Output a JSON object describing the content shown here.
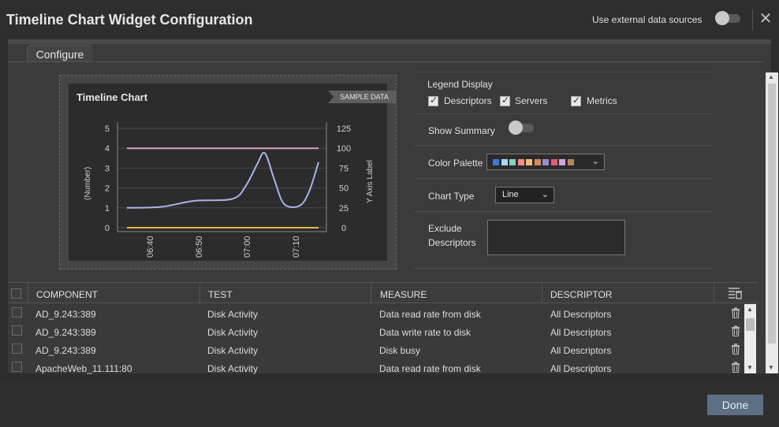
{
  "header": {
    "title": "Timeline Chart Widget Configuration",
    "external_sources_label": "Use external data sources",
    "external_sources_on": false
  },
  "tabs": [
    {
      "label": "Configure",
      "active": true
    }
  ],
  "preview": {
    "chart_title": "Timeline Chart",
    "badge": "SAMPLE DATA"
  },
  "chart_data": {
    "type": "line",
    "title": "Timeline Chart",
    "x": [
      "06:40",
      "06:50",
      "07:00",
      "07:10"
    ],
    "ylabel": "(Number)",
    "ylabel_right": "Y Axis Label",
    "yticks_left": [
      "0",
      "1",
      "2",
      "3",
      "4",
      "5"
    ],
    "yticks_right": [
      "0",
      "25",
      "50",
      "75",
      "100",
      "125"
    ],
    "ylim": [
      0,
      5
    ],
    "ylim_right": [
      0,
      125
    ],
    "grid": true,
    "series": [
      {
        "color": "#d8a0c8",
        "axis": "left",
        "points": [
          [
            0,
            4.0
          ],
          [
            1,
            4.0
          ]
        ]
      },
      {
        "color": "#e8b84a",
        "axis": "left",
        "points": [
          [
            0,
            0.0
          ],
          [
            1,
            0.0
          ]
        ]
      },
      {
        "color": "#aab4e8",
        "axis": "left",
        "points": [
          [
            0.0,
            1.0
          ],
          [
            0.18,
            1.05
          ],
          [
            0.35,
            1.35
          ],
          [
            0.55,
            1.45
          ],
          [
            0.62,
            2.1
          ],
          [
            0.68,
            3.2
          ],
          [
            0.72,
            3.75
          ],
          [
            0.77,
            2.4
          ],
          [
            0.82,
            1.2
          ],
          [
            0.9,
            1.1
          ],
          [
            0.95,
            1.8
          ],
          [
            1.0,
            3.3
          ]
        ]
      }
    ]
  },
  "settings": {
    "legend_display_label": "Legend Display",
    "legend_options": [
      {
        "label": "Descriptors",
        "checked": true
      },
      {
        "label": "Servers",
        "checked": true
      },
      {
        "label": "Metrics",
        "checked": true
      }
    ],
    "show_summary_label": "Show Summary",
    "show_summary_on": false,
    "color_palette_label": "Color Palette",
    "palette_colors": [
      "#3a7bd5",
      "#a8d8f0",
      "#7fd3c0",
      "#f28a8a",
      "#f5b97a",
      "#d68c5a",
      "#9b8ad6",
      "#e85a6e",
      "#c9a7e0",
      "#b5865a"
    ],
    "chart_type_label": "Chart Type",
    "chart_type_value": "Line",
    "exclude_descriptors_label_1": "Exclude",
    "exclude_descriptors_label_2": "Descriptors"
  },
  "table": {
    "columns": [
      "COMPONENT",
      "TEST",
      "MEASURE",
      "DESCRIPTOR"
    ],
    "rows": [
      {
        "component": "AD_9.243:389",
        "test": "Disk Activity",
        "measure": "Data read rate from disk",
        "descriptor": "All Descriptors"
      },
      {
        "component": "AD_9.243:389",
        "test": "Disk Activity",
        "measure": "Data write rate to disk",
        "descriptor": "All Descriptors"
      },
      {
        "component": "AD_9.243:389",
        "test": "Disk Activity",
        "measure": "Disk busy",
        "descriptor": "All Descriptors"
      },
      {
        "component": "ApacheWeb_11.111:80",
        "test": "Disk Activity",
        "measure": "Data read rate from disk",
        "descriptor": "All Descriptors"
      }
    ]
  },
  "footer": {
    "done_label": "Done"
  },
  "colors": {
    "accent_button": "#5d6f85"
  }
}
